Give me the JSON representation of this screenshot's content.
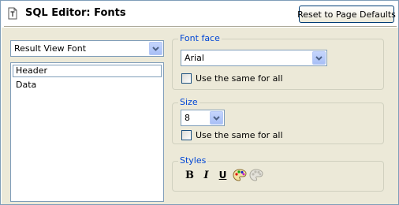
{
  "page": {
    "title": "SQL Editor: Fonts",
    "reset_label": "Reset to Page Defaults"
  },
  "font_category": {
    "selected": "Result View Font",
    "icon": "chevron-down-icon"
  },
  "elements": {
    "items": [
      {
        "label": "Header"
      },
      {
        "label": "Data"
      }
    ]
  },
  "font_face": {
    "legend": "Font face",
    "selected": "Arial",
    "same_for_all_label": "Use the same for all",
    "same_for_all_checked": false
  },
  "size": {
    "legend": "Size",
    "selected": "8",
    "same_for_all_label": "Use the same for all",
    "same_for_all_checked": false
  },
  "styles": {
    "legend": "Styles",
    "bold_label": "B",
    "italic_label": "I",
    "underline_label": "U",
    "color_icon": "palette-icon",
    "background_icon": "palette-disabled-icon"
  },
  "colors": {
    "legend_blue": "#0046d5",
    "panel_bg": "#ece9d8",
    "border_blue": "#7f9db9",
    "dropdown_button": "#a8bff6"
  }
}
